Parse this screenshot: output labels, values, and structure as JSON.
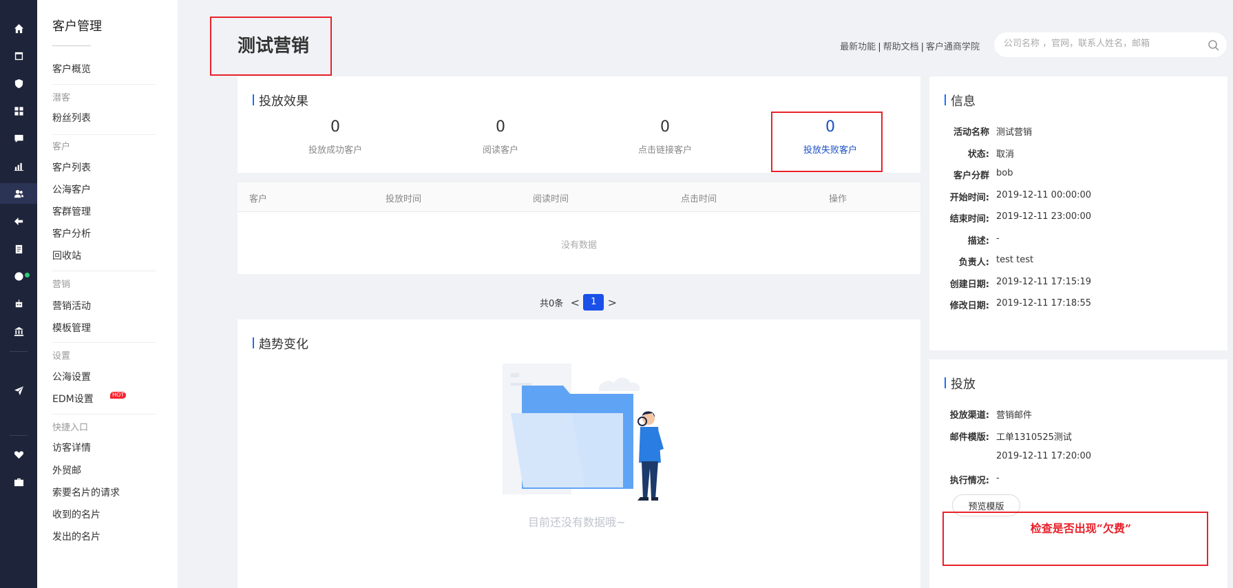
{
  "nav": {
    "section_title": "客户管理",
    "items": [
      {
        "type": "item",
        "label": "客户概览"
      },
      {
        "type": "group",
        "label": "潜客"
      },
      {
        "type": "item",
        "label": "粉丝列表"
      },
      {
        "type": "group",
        "label": "客户"
      },
      {
        "type": "item",
        "label": "客户列表"
      },
      {
        "type": "item",
        "label": "公海客户"
      },
      {
        "type": "item",
        "label": "客群管理"
      },
      {
        "type": "item",
        "label": "客户分析"
      },
      {
        "type": "item",
        "label": "回收站"
      },
      {
        "type": "group",
        "label": "营销"
      },
      {
        "type": "item",
        "label": "营销活动"
      },
      {
        "type": "item",
        "label": "模板管理"
      },
      {
        "type": "group",
        "label": "设置"
      },
      {
        "type": "item",
        "label": "公海设置"
      },
      {
        "type": "item",
        "label": "EDM设置"
      },
      {
        "type": "group",
        "label": "快捷入口"
      },
      {
        "type": "item",
        "label": "访客详情"
      },
      {
        "type": "item",
        "label": "外贸邮"
      },
      {
        "type": "item",
        "label": "索要名片的请求"
      },
      {
        "type": "item",
        "label": "收到的名片"
      },
      {
        "type": "item",
        "label": "发出的名片"
      }
    ],
    "hot_badge": "HOT"
  },
  "rail_icons": [
    "home-icon",
    "inbox-icon",
    "shield-icon",
    "apps-icon",
    "chat-icon",
    "bar-chart-icon",
    "users-icon",
    "share-icon",
    "clipboard-icon",
    "globe-icon",
    "robot-icon",
    "bank-icon",
    "send-icon",
    "heart-icon",
    "briefcase-icon"
  ],
  "header": {
    "title": "测试营销",
    "links": [
      "最新功能",
      "帮助文档",
      "客户通商学院"
    ],
    "link_sep": "|",
    "search_placeholder": "公司名称 ，官网，联系人姓名，邮箱"
  },
  "effect": {
    "title": "投放效果",
    "metrics": [
      {
        "value": "0",
        "label": "投放成功客户"
      },
      {
        "value": "0",
        "label": "阅读客户"
      },
      {
        "value": "0",
        "label": "点击链接客户"
      },
      {
        "value": "0",
        "label": "投放失败客户"
      }
    ]
  },
  "table": {
    "columns": [
      "客户",
      "投放时间",
      "阅读时间",
      "点击时间",
      "操作"
    ],
    "empty_text": "没有数据"
  },
  "pager": {
    "total_text": "共0条",
    "prev": "<",
    "current": "1",
    "next": ">"
  },
  "trend": {
    "title": "趋势变化",
    "empty_text": "目前还没有数据哦~"
  },
  "info": {
    "title": "信息",
    "rows": [
      {
        "key": "活动名称",
        "value": "测试营销"
      },
      {
        "key": "状态:",
        "value": "取消"
      },
      {
        "key": "客户分群",
        "value": "bob"
      },
      {
        "key": "开始时间:",
        "value": "2019-12-11 00:00:00"
      },
      {
        "key": "结束时间:",
        "value": "2019-12-11 23:00:00"
      },
      {
        "key": "描述:",
        "value": "-"
      },
      {
        "key": "负责人:",
        "value": "test test"
      },
      {
        "key": "创建日期:",
        "value": "2019-12-11 17:15:19"
      },
      {
        "key": "修改日期:",
        "value": "2019-12-11 17:18:55"
      }
    ]
  },
  "delivery": {
    "title": "投放",
    "rows": [
      {
        "key": "投放渠道:",
        "value": "营销邮件"
      },
      {
        "key": "邮件模版:",
        "value": "工单1310525测试"
      },
      {
        "key": "",
        "value": "2019-12-11 17:20:00"
      },
      {
        "key": "执行情况:",
        "value": "-"
      }
    ],
    "preview_button": "预览模版"
  },
  "annotation": "检查是否出现“欠费”",
  "colors": {
    "accent": "#1a4fe8",
    "annotation": "#e8202a",
    "rail": "#1e2439"
  }
}
